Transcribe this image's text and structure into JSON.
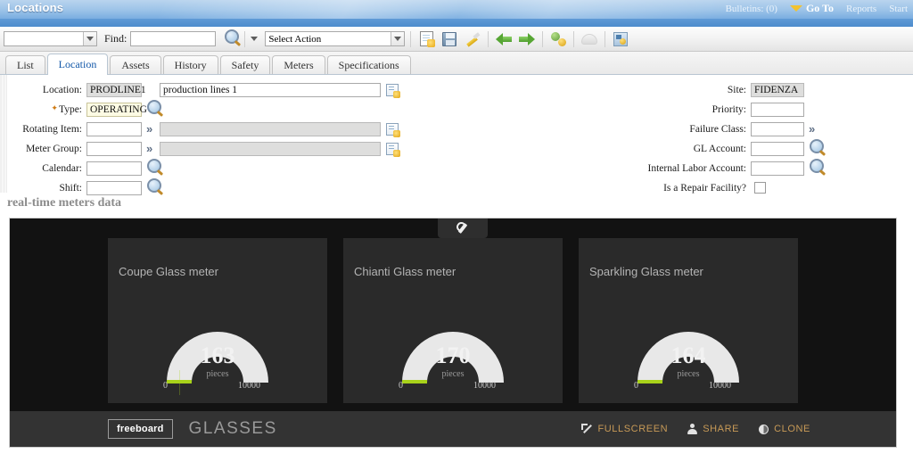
{
  "banner": {
    "title": "Locations",
    "bulletins": "Bulletins: (0)",
    "goto": "Go To",
    "reports": "Reports",
    "start": "Start"
  },
  "toolbar": {
    "quick_select_value": "",
    "find_label": "Find:",
    "find_value": "",
    "action_value": "Select Action",
    "icons": [
      "new-record-icon",
      "save-icon",
      "clear-changes-icon",
      "previous-record-icon",
      "next-record-icon",
      "workflow-icon",
      "print-icon",
      "reports-icon"
    ]
  },
  "tabs": [
    {
      "label": "List",
      "active": false
    },
    {
      "label": "Location",
      "active": true
    },
    {
      "label": "Assets",
      "active": false
    },
    {
      "label": "History",
      "active": false
    },
    {
      "label": "Safety",
      "active": false
    },
    {
      "label": "Meters",
      "active": false
    },
    {
      "label": "Specifications",
      "active": false
    }
  ],
  "form": {
    "left": {
      "location_label": "Location:",
      "location_value": "PRODLINE1",
      "location_desc": "production lines 1",
      "type_label": "Type:",
      "type_value": "OPERATING",
      "rotating_item_label": "Rotating Item:",
      "rotating_item_value": "",
      "rotating_item_desc": "",
      "meter_group_label": "Meter Group:",
      "meter_group_value": "",
      "meter_group_desc": "",
      "calendar_label": "Calendar:",
      "calendar_value": "",
      "shift_label": "Shift:",
      "shift_value": ""
    },
    "right": {
      "site_label": "Site:",
      "site_value": "FIDENZA",
      "priority_label": "Priority:",
      "priority_value": "",
      "failure_class_label": "Failure Class:",
      "failure_class_value": "",
      "gl_account_label": "GL Account:",
      "gl_account_value": "",
      "internal_labor_label": "Internal Labor Account:",
      "internal_labor_value": "",
      "repair_facility_label": "Is a Repair Facility?",
      "repair_facility_checked": false
    }
  },
  "section": {
    "title": "real-time meters data"
  },
  "dashboard": {
    "settings_icon": "wrench-icon",
    "logo": "freeboard",
    "name": "GLASSES",
    "actions": [
      {
        "label": "FULLSCREEN",
        "icon": "fullscreen-icon"
      },
      {
        "label": "SHARE",
        "icon": "person-icon"
      },
      {
        "label": "CLONE",
        "icon": "contrast-icon"
      }
    ],
    "accent_color": "#c79a57",
    "panel_color": "#2a2a2a",
    "background_color": "#121212",
    "gauge_track_color": "#e8e8e8",
    "gauge_value_color": "#a8d21a",
    "widgets": [
      {
        "title": "Coupe Glass meter",
        "value": "163",
        "unit": "pieces",
        "min": "0",
        "max": "10000"
      },
      {
        "title": "Chianti Glass meter",
        "value": "170",
        "unit": "pieces",
        "min": "0",
        "max": "10000"
      },
      {
        "title": "Sparkling Glass meter",
        "value": "164",
        "unit": "pieces",
        "min": "0",
        "max": "10000"
      }
    ]
  }
}
